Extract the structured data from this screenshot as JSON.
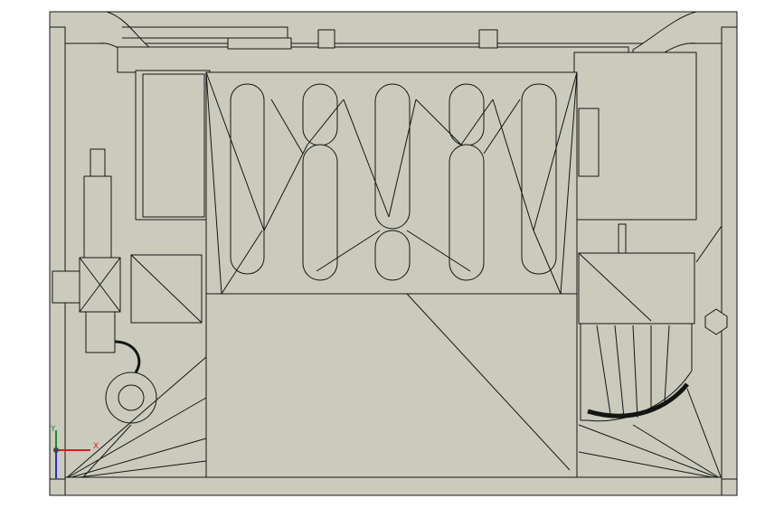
{
  "view": {
    "background": "#ffffff",
    "model_fill": "#cbcbbd",
    "edge_color": "#141414"
  },
  "triad": {
    "x_label": "X",
    "y_label": "Y",
    "x_color": "#d61e1e",
    "y_color": "#1d8a2a",
    "z_color": "#2233cc"
  }
}
